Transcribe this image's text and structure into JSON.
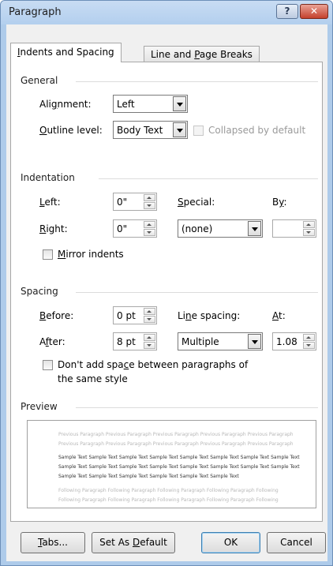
{
  "window": {
    "title": "Paragraph",
    "help_label": "?",
    "close_label": "✕"
  },
  "tabs": [
    {
      "pre": "",
      "key": "I",
      "post": "ndents and Spacing"
    },
    {
      "pre": "Line and ",
      "key": "P",
      "post": "age Breaks"
    }
  ],
  "general": {
    "title": "General",
    "alignment": {
      "pre": "Ali",
      "key": "g",
      "post": "nment:",
      "value": "Left"
    },
    "outline": {
      "pre": "",
      "key": "O",
      "post": "utline level:",
      "value": "Body Text"
    },
    "collapsed_label": "Collapsed by default"
  },
  "indentation": {
    "title": "Indentation",
    "left": {
      "pre": "",
      "key": "L",
      "post": "eft:",
      "value": "0\""
    },
    "right": {
      "pre": "",
      "key": "R",
      "post": "ight:",
      "value": "0\""
    },
    "special": {
      "pre": "",
      "key": "S",
      "post": "pecial:",
      "value": "(none)"
    },
    "by": {
      "pre": "B",
      "key": "y",
      "post": ":",
      "value": ""
    },
    "mirror": {
      "pre": "",
      "key": "M",
      "post": "irror indents"
    }
  },
  "spacing": {
    "title": "Spacing",
    "before": {
      "pre": "",
      "key": "B",
      "post": "efore:",
      "value": "0 pt"
    },
    "after": {
      "pre": "A",
      "key": "f",
      "post": "ter:",
      "value": "8 pt"
    },
    "line_spacing": {
      "pre": "Li",
      "key": "n",
      "post": "e spacing:",
      "value": "Multiple"
    },
    "at": {
      "pre": "",
      "key": "A",
      "post": "t:",
      "value": "1.08"
    },
    "dont_add": {
      "line1_pre": "Don't add spa",
      "key": "c",
      "line1_post": "e between paragraphs of",
      "line2": "the same style"
    }
  },
  "preview": {
    "title": "Preview",
    "prev_lines": [
      "Previous Paragraph Previous Paragraph Previous Paragraph Previous Paragraph Previous Paragraph",
      "Previous Paragraph Previous Paragraph Previous Paragraph Previous Paragraph Previous Paragraph"
    ],
    "sample_lines": [
      "Sample Text Sample Text Sample Text Sample Text Sample Text Sample Text Sample Text Sample Text",
      "Sample Text Sample Text Sample Text Sample Text Sample Text Sample Text Sample Text Sample Text",
      "Sample Text Sample Text Sample Text Sample Text Sample Text Sample Text"
    ],
    "follow_lines": [
      "Following Paragraph Following Paragraph Following Paragraph Following Paragraph Following",
      "Following Paragraph Following Paragraph Following Paragraph Following Paragraph Following"
    ]
  },
  "buttons": {
    "tabs": {
      "pre": "",
      "key": "T",
      "post": "abs..."
    },
    "set_default": {
      "pre": "Set As ",
      "key": "D",
      "post": "efault"
    },
    "ok": "OK",
    "cancel": "Cancel"
  }
}
